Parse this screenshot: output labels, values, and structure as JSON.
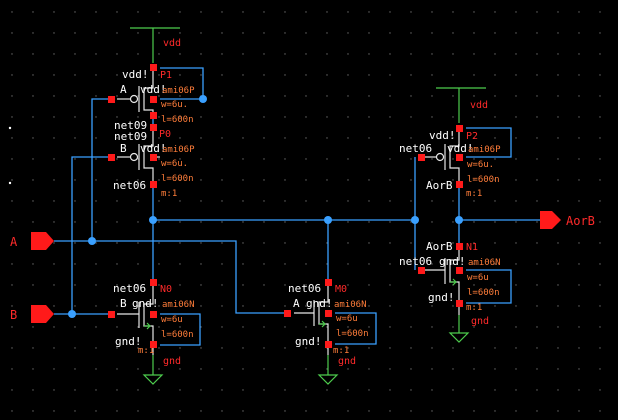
{
  "supply": {
    "vdd_label": "vdd",
    "gnd_label": "gnd"
  },
  "pins": {
    "input_a": "A",
    "input_b": "B",
    "output": "AorB"
  },
  "nets": {
    "vddbang": "vdd!",
    "gndbang": "gnd!",
    "net09": "net09",
    "net06": "net06"
  },
  "transistors": [
    {
      "name": "P1",
      "model": "ami06P",
      "gate": "A",
      "source": "vdd!",
      "bulk": "vdd!",
      "drain": "net09",
      "w": "w=6u.",
      "l": "l=600n",
      "m": "m:1"
    },
    {
      "name": "P0",
      "model": "ami06P",
      "gate": "B",
      "source": "net09",
      "bulk": "vdd!",
      "drain": "net06",
      "w": "w=6u.",
      "l": "l=600n",
      "m": "m:1"
    },
    {
      "name": "N0",
      "model": "ami06N",
      "gate": "B",
      "source": "gnd!",
      "bulk": "gnd!",
      "drain": "net06",
      "w": "w=6u",
      "l": "l=600n",
      "m": "m:1"
    },
    {
      "name": "M0",
      "model": "ami06N",
      "gate": "A",
      "source": "gnd!",
      "bulk": "gnd!",
      "drain": "net06",
      "w": "w=6u",
      "l": "l=600n",
      "m": "m:1"
    },
    {
      "name": "P2",
      "model": "ami06P",
      "gate": "net06",
      "source": "vdd!",
      "bulk": "vdd!",
      "drain": "AorB",
      "w": "w=6u.",
      "l": "l=600n",
      "m": "m:1"
    },
    {
      "name": "N1",
      "model": "ami06N",
      "gate": "net06",
      "source": "gnd!",
      "bulk": "gnd!",
      "drain": "AorB",
      "w": "w=6u",
      "l": "l=600n",
      "m": "m:1"
    }
  ],
  "colors": {
    "background": "#000000",
    "wire": "#3aa0ff",
    "pin": "#ff1a1a",
    "label": "#ff2a2a",
    "param": "#ff7d3a",
    "supply": "#4dcc4d"
  }
}
